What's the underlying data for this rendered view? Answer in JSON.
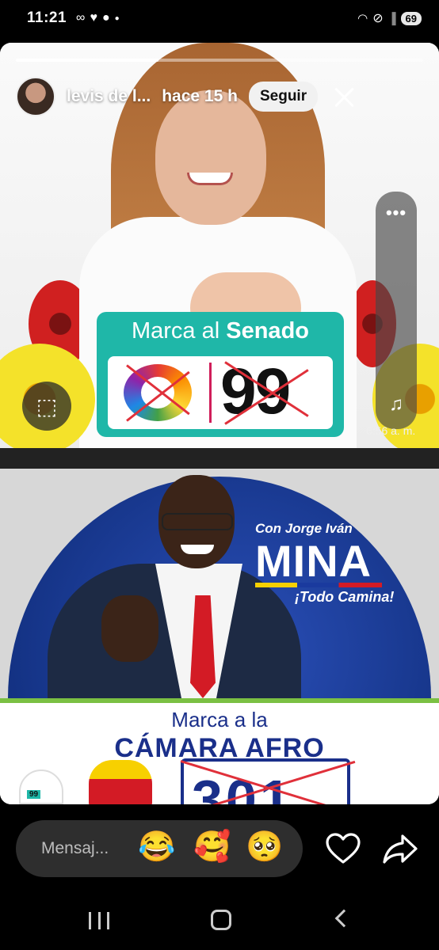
{
  "status_bar": {
    "time": "11:21",
    "battery": "69"
  },
  "story": {
    "progress": 0.35,
    "user_name": "levis de l...",
    "time_ago": "hace 15 h",
    "follow_label": "Seguir",
    "more_label": "•••",
    "posted_time": "6:56 a. m.",
    "panel1": {
      "ballot_title_pre": "Marca al ",
      "ballot_title_bold": "Senado",
      "ballot_number": "99"
    },
    "panel2": {
      "brand_sub": "Con Jorge Iván",
      "brand_main": "MINA",
      "brand_slogan": "¡Todo Camina!",
      "band_line1": "Marca a la",
      "band_line2": "CÁMARA AFRO",
      "ballot_number": "301",
      "mini_thumb_number": "99"
    }
  },
  "reply_bar": {
    "placeholder": "Mensaj...",
    "emojis": [
      "😂",
      "🥰",
      "🥺"
    ]
  },
  "icons": {
    "lens": "lens-icon",
    "music": "music-icon",
    "heart": "heart-icon",
    "share": "share-icon",
    "close": "close-icon"
  }
}
